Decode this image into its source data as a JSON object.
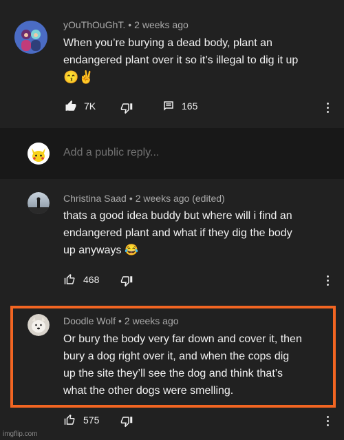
{
  "parent_comment": {
    "author": "yOuThOuGhT.",
    "time": "2 weeks ago",
    "lines": [
      "When you’re burying a dead body, plant an",
      "endangered plant over it so it’s illegal to dig it up"
    ],
    "emoji": "😙✌️",
    "likes": "7K",
    "replies_count": "165"
  },
  "reply_box": {
    "placeholder": "Add a public reply..."
  },
  "replies": [
    {
      "author": "Christina Saad",
      "time": "2 weeks ago (edited)",
      "lines": [
        "thats a good idea buddy but where will i find an",
        "endangered plant and what if they dig the body",
        "up anyways 😂"
      ],
      "likes": "468"
    },
    {
      "author": "Doodle Wolf",
      "time": "2 weeks ago",
      "lines": [
        "Or bury the body very far down and cover it, then",
        "bury a dog right over it, and when the cops dig",
        "up the site they’ll see the dog and think that’s",
        "what the other dogs were smelling."
      ],
      "likes": "575"
    }
  ],
  "watermark": "imgflip.com",
  "colors": {
    "highlight": "#f26522",
    "background": "#181818",
    "card": "#212121"
  }
}
